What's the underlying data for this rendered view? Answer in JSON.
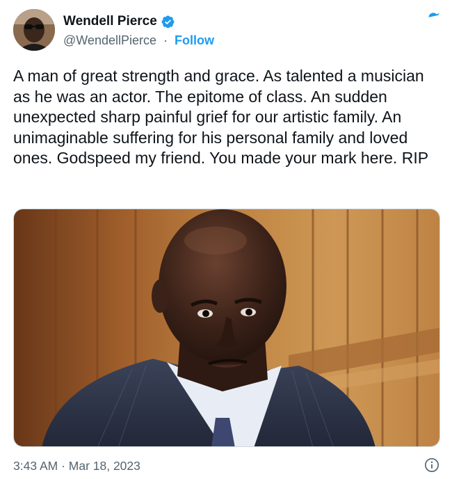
{
  "author": {
    "display_name": "Wendell Pierce",
    "handle": "@WendellPierce",
    "separator": "·",
    "follow_label": "Follow",
    "verified": true
  },
  "tweet": {
    "text": "A man of great strength and grace. As talented a musician as he was an actor. The epitome of class. An sudden unexpected sharp painful grief for our artistic family. An unimaginable suffering for his personal family and loved ones. Godspeed my friend. You made your mark here. RIP",
    "timestamp": "3:43 AM · Mar 18, 2023"
  },
  "icons": {
    "logo": "twitter-bird-icon",
    "verified": "verified-badge-icon",
    "info": "info-icon"
  },
  "colors": {
    "accent": "#1d9bf0",
    "text": "#0f1419",
    "secondary": "#536471"
  }
}
